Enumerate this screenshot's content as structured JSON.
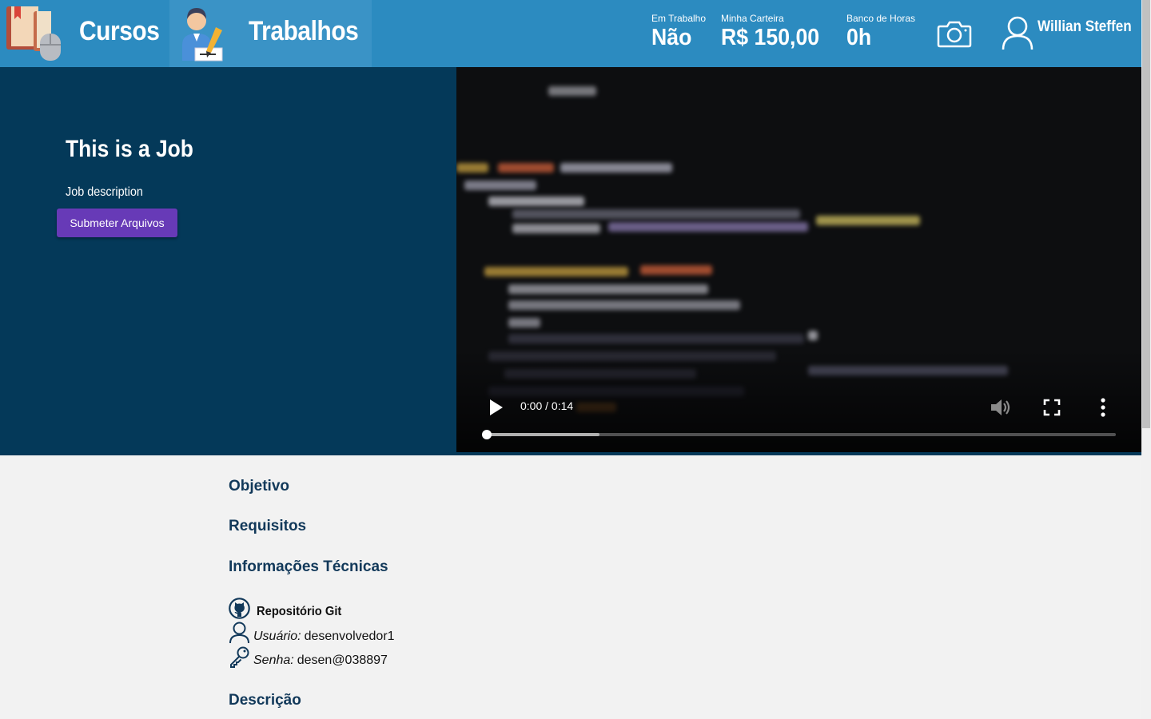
{
  "header": {
    "nav": {
      "cursos": "Cursos",
      "trabalhos": "Trabalhos"
    },
    "stats": {
      "em_trabalho": {
        "label": "Em Trabalho",
        "value": "Não"
      },
      "carteira": {
        "label": "Minha Carteira",
        "value": "R$ 150,00"
      },
      "banco_horas": {
        "label": "Banco de Horas",
        "value": "0h"
      }
    },
    "user_name": "Willian Steffen",
    "camera_icon": "camera-icon",
    "user_icon": "user-icon"
  },
  "job": {
    "title": "This is a Job",
    "description": "Job description",
    "submit_label": "Submeter Arquivos"
  },
  "video": {
    "time": "0:00 / 0:14",
    "progress": 0,
    "buffered": 0.18
  },
  "sections": {
    "objetivo": "Objetivo",
    "requisitos": "Requisitos",
    "informacoes": "Informações Técnicas",
    "descricao": "Descrição"
  },
  "repo": {
    "title": "Repositório Git",
    "user_label": "Usuário:",
    "user_value": "desenvolvedor1",
    "pass_label": "Senha:",
    "pass_value": "desen@038897"
  },
  "colors": {
    "header": "#2c8bc0",
    "hero": "#043959",
    "accent": "#673ab7",
    "section_title": "#12395a"
  }
}
